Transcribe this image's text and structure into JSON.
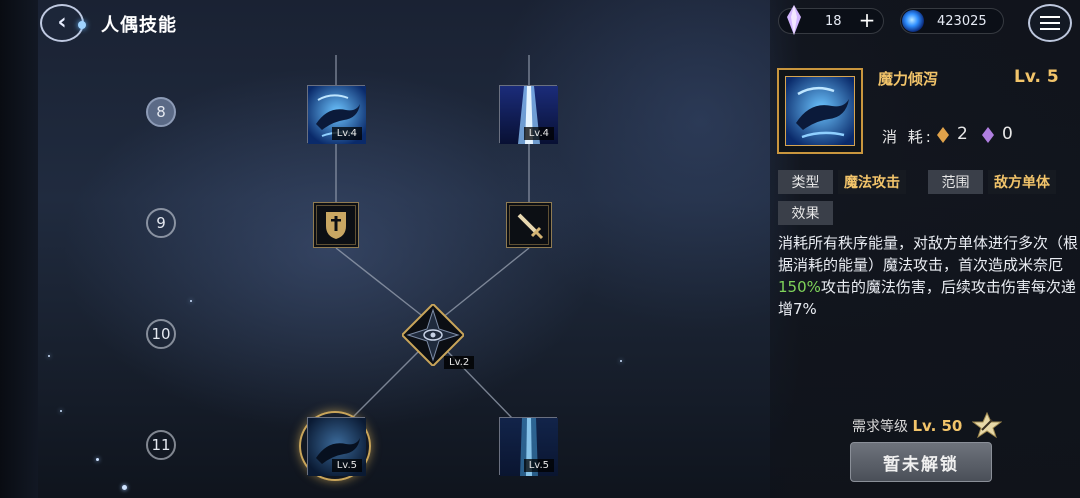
{
  "header": {
    "title": "人偶技能",
    "crystal_count": "18",
    "mana_count": "423025"
  },
  "tree": {
    "rows": [
      "8",
      "9",
      "10",
      "11"
    ],
    "active_row": "8",
    "skills": {
      "r8_left_lv": "Lv.4",
      "r8_right_lv": "Lv.4",
      "center_lv": "Lv.2",
      "r11_left_lv": "Lv.5",
      "r11_right_lv": "Lv.5"
    }
  },
  "detail": {
    "name": "魔力倾泻",
    "level": "Lv. 5",
    "cost_label": "消 耗:",
    "cost_orange": "2",
    "cost_purple": "0",
    "type_label": "类型",
    "type_value": "魔法攻击",
    "range_label": "范围",
    "range_value": "敌方单体",
    "effect_label": "效果",
    "desc_part1": "消耗所有秩序能量，对敌方单体进行多次（根据消耗的能量）魔法攻击，首次造成米奈厄",
    "desc_highlight": "150%",
    "desc_part2": "攻击的魔法伤害，后续攻击伤害每次递增7%",
    "req_label": "需求等级",
    "req_level": "Lv. 50",
    "unlock_button": "暂未解锁"
  },
  "colors": {
    "gold": "#f2c46a",
    "highlight_green": "#7fd35a"
  }
}
